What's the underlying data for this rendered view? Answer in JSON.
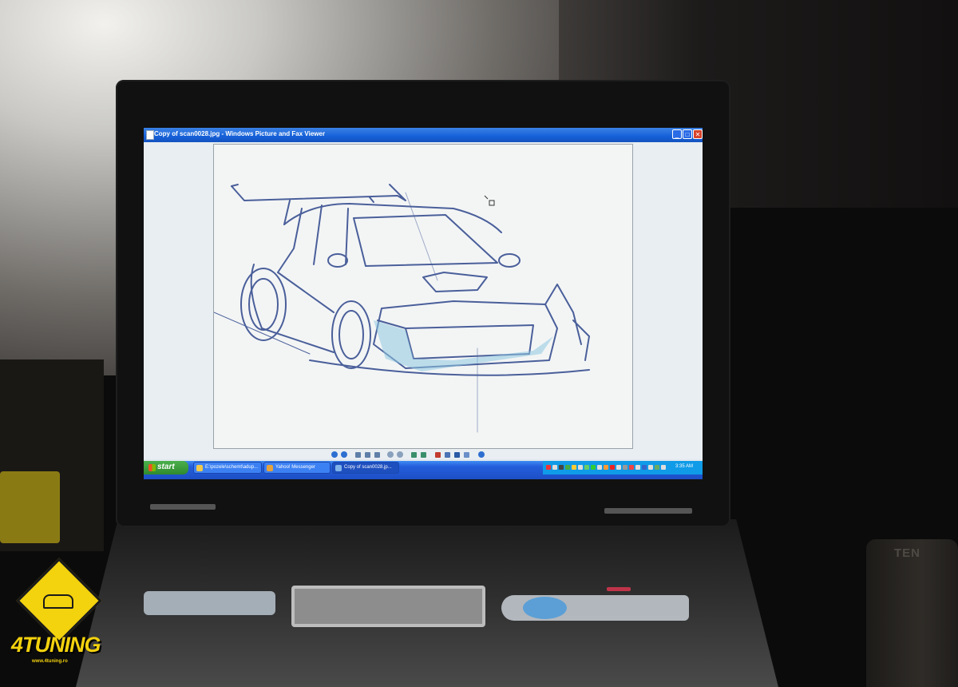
{
  "window": {
    "title": "Copy of scan0028.jpg - Windows Picture and Fax Viewer",
    "minimize_glyph": "_",
    "maximize_glyph": "□",
    "close_glyph": "✕"
  },
  "viewer": {
    "image_subject": "pencil sketch of a tuned rally car with rear wing"
  },
  "taskbar": {
    "start_label": "start",
    "tasks": [
      {
        "label": "E:\\pozele\\schemt\\adup...",
        "icon": "folder-icon",
        "active": false
      },
      {
        "label": "Yahoo! Messenger",
        "icon": "messenger-icon",
        "active": false
      },
      {
        "label": "Copy of scan0028.jp...",
        "icon": "picture-viewer-icon",
        "active": true
      }
    ],
    "clock": "3:35 AM"
  },
  "watermark": {
    "brand": "4TUNING",
    "url": "www.4tuning.ro"
  },
  "background": {
    "cup_text": "TEN"
  },
  "colors": {
    "titlebar": "#1560d8",
    "taskbar": "#245edb",
    "start_button": "#2e8a2e",
    "sketch_line": "#4a5f9a",
    "sketch_fill": "#8ec6e0",
    "watermark": "#f3d20e"
  }
}
